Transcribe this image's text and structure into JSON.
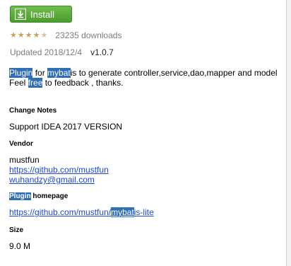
{
  "header": {
    "install_label": "Install"
  },
  "rating": {
    "stars": 4.5,
    "downloads": "23235 downloads"
  },
  "meta": {
    "updated": "Updated 2018/12/4",
    "version": "v1.0.7"
  },
  "description": {
    "line1_hl1": "Plugin",
    "line1_t1": " for ",
    "line1_hl2": "mybat",
    "line1_t2": "is to generate controller,service,dao,mapper and model",
    "line2_t1": "Feel ",
    "line2_hl": "free",
    "line2_t2": " to feedback , thanks."
  },
  "change_notes": {
    "title": "Change Notes",
    "text": "Support IDEA 2017 VERSION"
  },
  "vendor": {
    "title": "Vendor",
    "name": "mustfun",
    "url": "https://github.com/mustfun",
    "email": "wuhandzy@gmail.com"
  },
  "homepage": {
    "title_hl": "Plugin",
    "title_rest": " homepage",
    "url_pre": "https://github.com/mustfun/",
    "url_hl": "mybat",
    "url_post": "is-lite"
  },
  "size": {
    "title": "Size",
    "value": "9.0 M"
  },
  "colors": {
    "install_green": "#5aab3a",
    "highlight": "#2f6db5",
    "link": "#1f49c9",
    "muted": "#7c7c7c"
  }
}
